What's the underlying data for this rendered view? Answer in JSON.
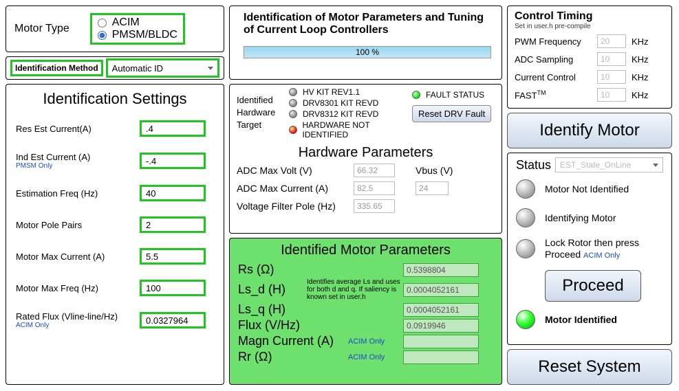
{
  "motorType": {
    "label": "Motor Type",
    "options": [
      "ACIM",
      "PMSM/BLDC"
    ],
    "selected": 1
  },
  "idMethod": {
    "label": "Identification Method",
    "value": "Automatic ID"
  },
  "idSettings": {
    "title": "Identification Settings",
    "rows": [
      {
        "label": "Res Est Current(A)",
        "sub": "",
        "val": ".4"
      },
      {
        "label": "Ind Est Current (A)",
        "sub": "PMSM Only",
        "val": "-.4"
      },
      {
        "label": "Estimation Freq (Hz)",
        "sub": "",
        "val": "40"
      },
      {
        "label": "Motor Pole Pairs",
        "sub": "",
        "val": "2"
      },
      {
        "label": "Motor Max Current (A)",
        "sub": "",
        "val": "5.5"
      },
      {
        "label": "Motor Max Freq (Hz)",
        "sub": "",
        "val": "100"
      },
      {
        "label": "Rated Flux (Vline-line/Hz)",
        "sub": "ACIM Only",
        "val": "0.0327964"
      }
    ]
  },
  "mainTitle": "Identification of Motor Parameters and Tuning of Current Loop Controllers",
  "progress": "100 %",
  "hw": {
    "targetLabel": "Identified Hardware Target",
    "items": [
      "HV KIT REV1.1",
      "DRV8301 KIT REVD",
      "DRV8312 KIT REVD",
      "HARDWARE NOT IDENTIFIED"
    ],
    "faultStatus": "FAULT STATUS",
    "resetBtn": "Reset DRV Fault",
    "paramsTitle": "Hardware Parameters",
    "adcMaxVoltLabel": "ADC Max Volt (V)",
    "adcMaxVolt": "66.32",
    "vbusLabel": "Vbus (V)",
    "adcMaxCurrentLabel": "ADC Max Current (A)",
    "adcMaxCurrent": "82.5",
    "vbus": "24",
    "vfpLabel": "Voltage Filter Pole (Hz)",
    "vfp": "335.65"
  },
  "motorParams": {
    "title": "Identified Motor Parameters",
    "note": "Identifies average Ls and uses for both d and q. If saliency is known set in user.h",
    "acimOnly": "ACIM Only",
    "rows": [
      {
        "label": "Rs (Ω)",
        "val": "0.5398804"
      },
      {
        "label": "Ls_d (H)",
        "val": "0.0004052161"
      },
      {
        "label": "Ls_q (H)",
        "val": "0.0004052161"
      },
      {
        "label": "Flux (V/Hz)",
        "val": "0.0919946"
      },
      {
        "label": "Magn Current (A)",
        "val": ""
      },
      {
        "label": "Rr (Ω)",
        "val": ""
      }
    ]
  },
  "ctrlTiming": {
    "title": "Control Timing",
    "sub": "Set in user.h pre-compile",
    "rows": [
      {
        "label": "PWM Frequency",
        "val": "20",
        "unit": "KHz"
      },
      {
        "label": "ADC Sampling",
        "val": "10",
        "unit": "KHz"
      },
      {
        "label": "Current Control",
        "val": "10",
        "unit": "KHz"
      },
      {
        "label": "FAST",
        "val": "10",
        "unit": "KHz"
      }
    ]
  },
  "identifyBtn": "Identify Motor",
  "status": {
    "title": "Status",
    "state": "EST_State_OnLine",
    "items": [
      {
        "text": "Motor Not Identified",
        "on": false
      },
      {
        "text": "Identifying Motor",
        "on": false
      },
      {
        "text": "Lock Rotor then press Proceed",
        "on": false,
        "sub": "ACIM Only"
      }
    ],
    "proceedBtn": "Proceed",
    "identified": {
      "text": "Motor Identified",
      "on": true
    }
  },
  "resetBtn": "Reset System"
}
